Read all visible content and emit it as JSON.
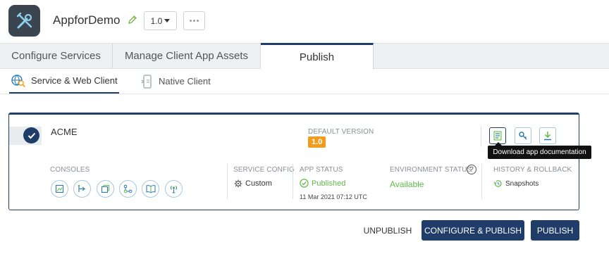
{
  "header": {
    "app_name": "AppforDemo",
    "version": "1.0",
    "app_icon": "tools-icon",
    "edit_icon": "pencil-icon",
    "more_icon": "ellipsis-icon"
  },
  "tabs": [
    {
      "label": "Configure Services"
    },
    {
      "label": "Manage Client App Assets"
    },
    {
      "label": "Publish"
    }
  ],
  "subtabs": [
    {
      "label": "Service & Web Client",
      "icon": "globe-search-icon"
    },
    {
      "label": "Native Client",
      "icon": "mobile-device-icon"
    }
  ],
  "environment": {
    "name": "ACME",
    "default_version_label": "DEFAULT VERSION",
    "default_version": "1.0",
    "consoles_label": "CONSOLES",
    "service_config_label": "SERVICE CONFIG",
    "service_config_value": "Custom",
    "app_status_label": "APP STATUS",
    "app_status_value": "Published",
    "app_status_date": "11 Mar 2021 07:12 UTC",
    "environment_status_label": "ENVIRONMENT STATUS",
    "environment_status_value": "Available",
    "history_label": "HISTORY & ROLLBACK",
    "history_value": "Snapshots",
    "tooltip": "Download app documentation"
  },
  "actions": {
    "unpublish": "UNPUBLISH",
    "configure_publish": "CONFIGURE & PUBLISH",
    "publish": "PUBLISH"
  },
  "colors": {
    "primary": "#1f3d68",
    "badge": "#f29c1f",
    "status_green": "#5fb94a",
    "icon_outline": "#a8c7e0"
  }
}
